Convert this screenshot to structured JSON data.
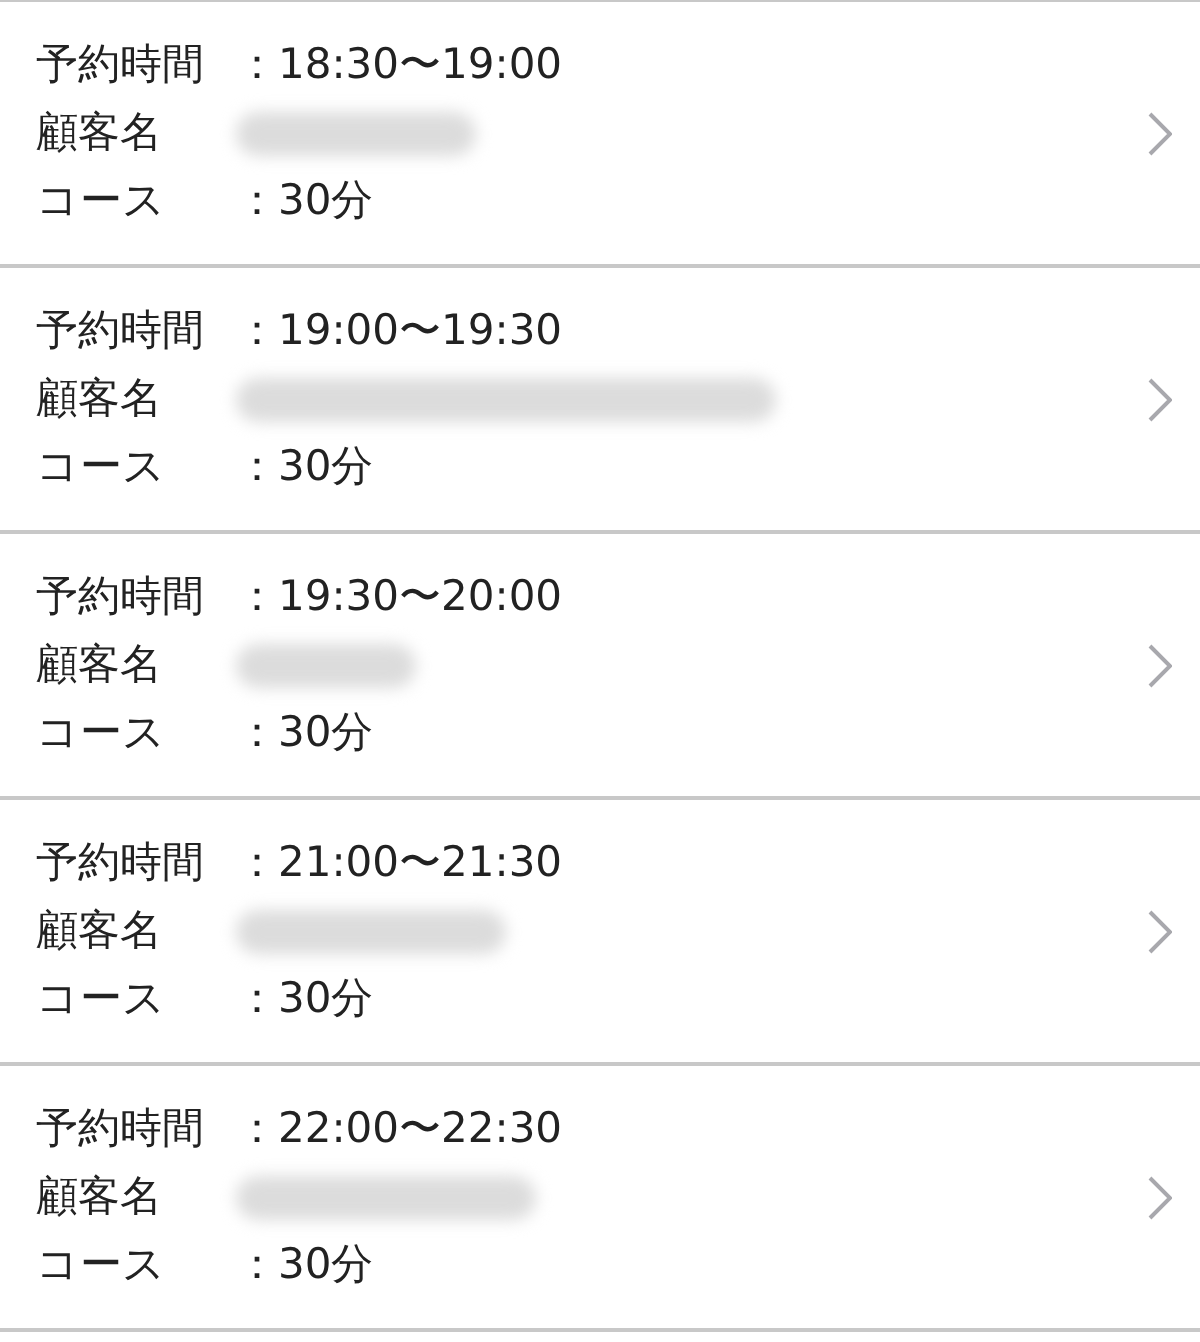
{
  "reservations": [
    {
      "time_label": "予約時間",
      "time": "：18:30〜19:00",
      "customer_label": "顧客名",
      "course_label": "コース",
      "course": "：30分"
    },
    {
      "time_label": "予約時間",
      "time": "：19:00〜19:30",
      "customer_label": "顧客名",
      "course_label": "コース",
      "course": "：30分"
    },
    {
      "time_label": "予約時間",
      "time": "：19:30〜20:00",
      "customer_label": "顧客名",
      "course_label": "コース",
      "course": "：30分"
    },
    {
      "time_label": "予約時間",
      "time": "：21:00〜21:30",
      "customer_label": "顧客名",
      "course_label": "コース",
      "course": "：30分"
    },
    {
      "time_label": "予約時間",
      "time": "：22:00〜22:30",
      "customer_label": "顧客名",
      "course_label": "コース",
      "course": "：30分"
    }
  ]
}
